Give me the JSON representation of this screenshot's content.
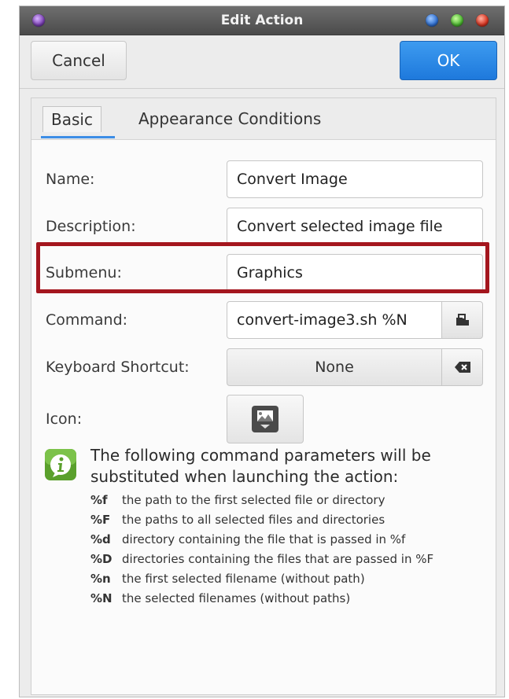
{
  "window": {
    "title": "Edit Action"
  },
  "header": {
    "cancel_label": "Cancel",
    "ok_label": "OK"
  },
  "tabs": [
    {
      "label": "Basic",
      "active": true
    },
    {
      "label": "Appearance Conditions",
      "active": false
    }
  ],
  "form": {
    "name": {
      "label": "Name:",
      "value": "Convert Image"
    },
    "description": {
      "label": "Description:",
      "value": "Convert selected image file"
    },
    "submenu": {
      "label": "Submenu:",
      "value": "Graphics"
    },
    "command": {
      "label": "Command:",
      "value": "convert-image3.sh %N"
    },
    "shortcut": {
      "label": "Keyboard Shortcut:",
      "value": "None"
    },
    "icon": {
      "label": "Icon:"
    }
  },
  "info": {
    "line1": "The following command parameters will be",
    "line2": "substituted when launching the action:",
    "params": [
      {
        "key": "%f",
        "desc": "the path to the first selected file or directory"
      },
      {
        "key": "%F",
        "desc": "the paths to all selected files and directories"
      },
      {
        "key": "%d",
        "desc": "directory containing the file that is passed in %f"
      },
      {
        "key": "%D",
        "desc": "directories containing the files that are passed in %F"
      },
      {
        "key": "%n",
        "desc": "the first selected filename (without path)"
      },
      {
        "key": "%N",
        "desc": "the selected filenames (without paths)"
      }
    ]
  },
  "colors": {
    "accent": "#1e79dc",
    "highlight": "#a4161e",
    "info_icon": "#5aa02c"
  }
}
